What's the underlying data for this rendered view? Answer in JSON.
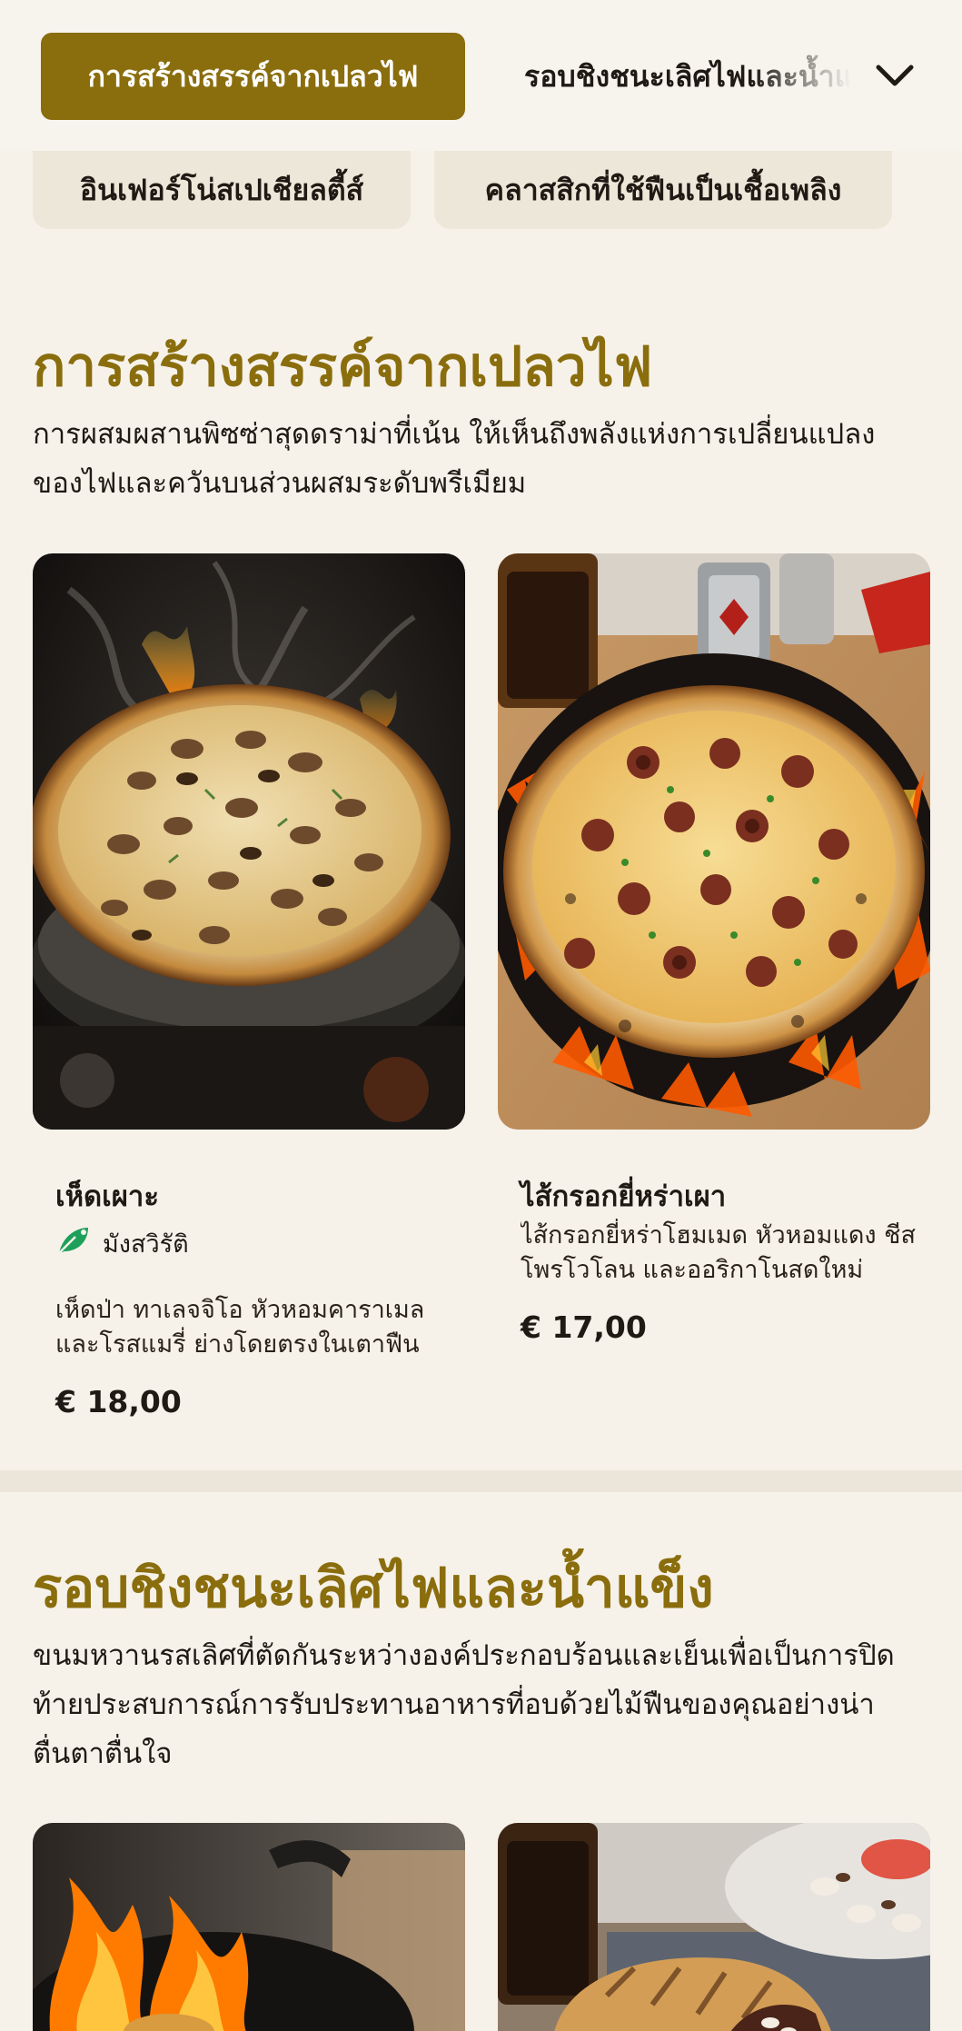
{
  "nav": {
    "active_category": "การสร้างสรรค์จากเปลวไฟ",
    "next_category": "รอบชิงชนะเลิศไฟและน้ำแข็ง",
    "expand_icon": "chevron-down-icon"
  },
  "subcategories": [
    "อินเฟอร์โน่สเปเชียลตี้ส์",
    "คลาสสิกที่ใช้ฟืนเป็นเชื้อเพลิง"
  ],
  "sections": [
    {
      "title": "การสร้างสรรค์จากเปลวไฟ",
      "description": "การผสมผสานพิซซ่าสุดดราม่าที่เน้น ให้เห็นถึงพลังแห่งการเปลี่ยนแปลงของไฟและควันบนส่วนผสมระดับพรีเมียม",
      "items": [
        {
          "name": "เห็ดเผาะ",
          "tag": "มังสวิรัติ",
          "tag_icon": "vegetarian-leaf-icon",
          "description": "เห็ดป่า ทาเลจจิโอ หัวหอมคาราเมล และโรสแมรี่ ย่างโดยตรงในเตาฟืน",
          "price": "€ 18,00"
        },
        {
          "name": "ไส้กรอกยี่หร่าเผา",
          "description": "ไส้กรอกยี่หร่าโฮมเมด หัวหอมแดง ชีสโพรโวโลน และออริกาโนสดใหม่",
          "price": "€ 17,00"
        }
      ]
    },
    {
      "title": "รอบชิงชนะเลิศไฟและน้ำแข็ง",
      "description": "ขนมหวานรสเลิศที่ตัดกันระหว่างองค์ประกอบร้อนและเย็นเพื่อเป็นการปิดท้ายประสบการณ์การรับประทานอาหารที่อบด้วยไม้ฟืนของคุณอย่างน่าตื่นตาตื่นใจ"
    }
  ],
  "colors": {
    "accent": "#8a6d0d",
    "background": "#f6f2ea",
    "chip": "#ede7da",
    "veg_green": "#1fa05a"
  }
}
